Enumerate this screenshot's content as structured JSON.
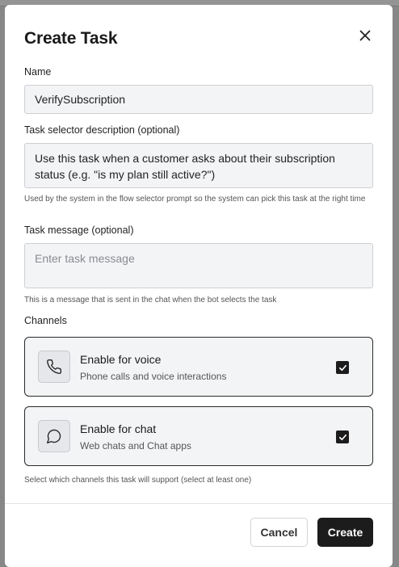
{
  "dialog": {
    "title": "Create Task"
  },
  "form": {
    "name": {
      "label": "Name",
      "value": "VerifySubscription"
    },
    "selector_description": {
      "label": "Task selector description (optional)",
      "value": "Use this task when a customer asks about their subscription status (e.g. \"is my plan still active?\")",
      "help": "Used by the system in the flow selector prompt so the system can pick this task at the right time"
    },
    "task_message": {
      "label": "Task message (optional)",
      "placeholder": "Enter task message",
      "value": "",
      "help": "This is a message that is sent in the chat when the bot selects the task"
    },
    "channels": {
      "label": "Channels",
      "help": "Select which channels this task will support (select at least one)",
      "items": [
        {
          "title": "Enable for voice",
          "subtitle": "Phone calls and voice interactions",
          "icon": "phone-icon",
          "checked": true
        },
        {
          "title": "Enable for chat",
          "subtitle": "Web chats and Chat apps",
          "icon": "chat-bubble-icon",
          "checked": true
        }
      ]
    }
  },
  "footer": {
    "cancel_label": "Cancel",
    "create_label": "Create"
  },
  "colors": {
    "primary": "#1c1c1c",
    "field_background": "#f3f4f6",
    "border": "#cfcfd3"
  }
}
